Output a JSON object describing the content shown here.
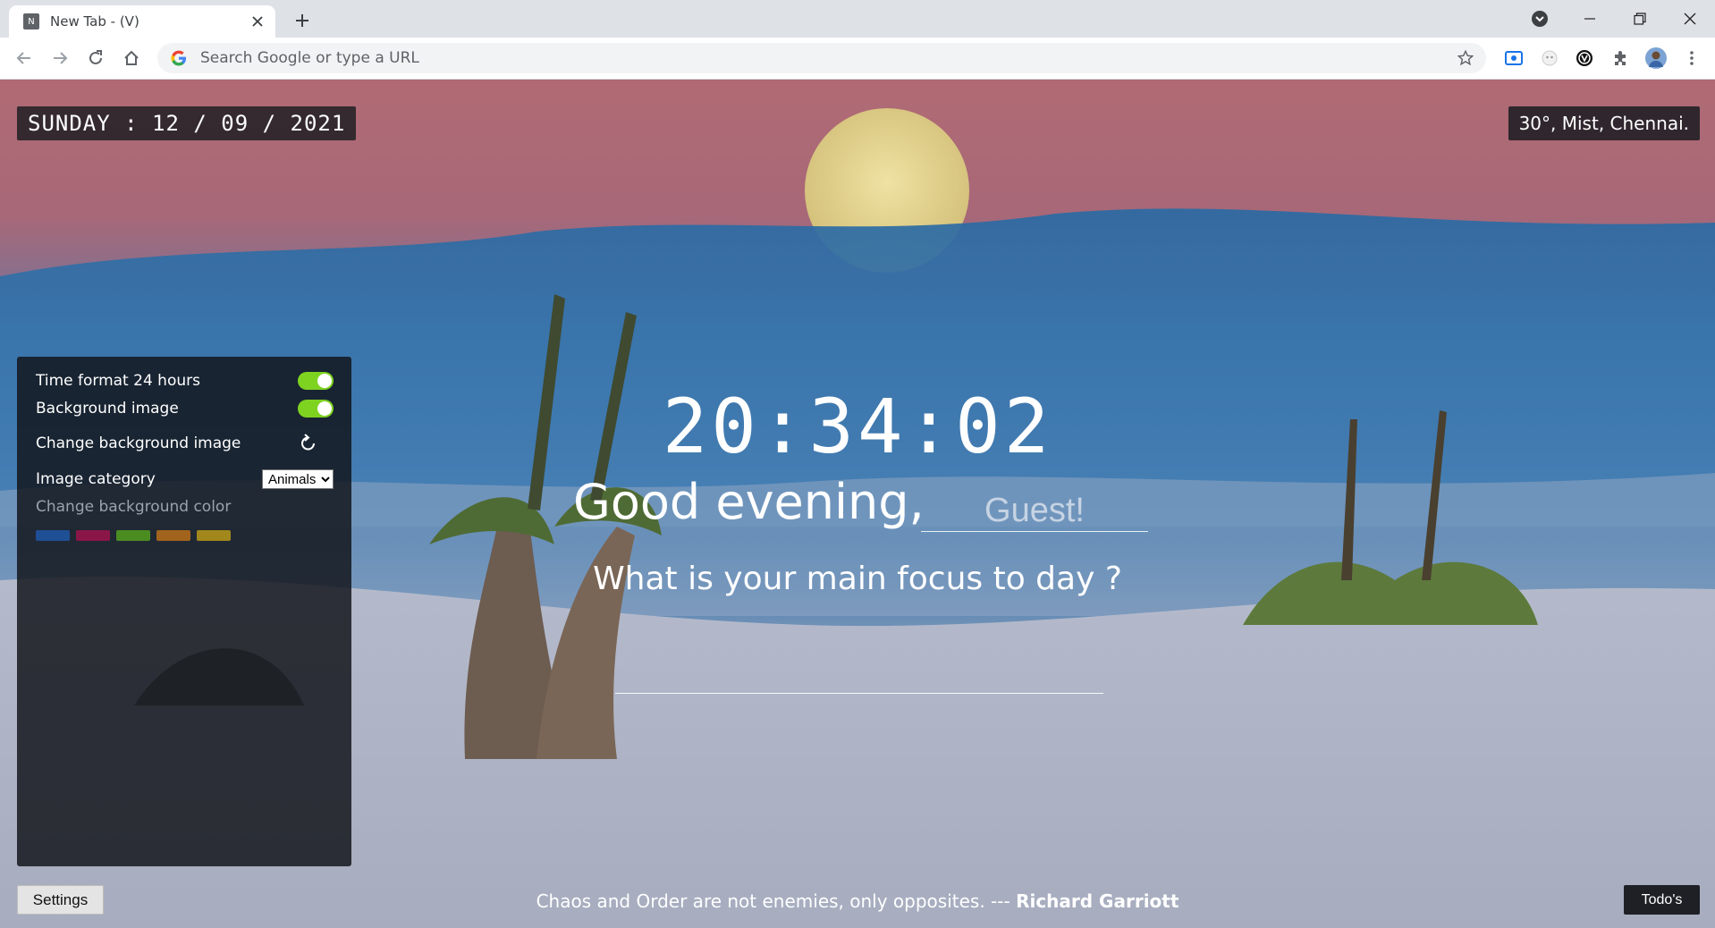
{
  "browser": {
    "tab_title": "New Tab - (V)",
    "tab_favicon_letter": "N",
    "omnibox_placeholder": "Search Google or type a URL"
  },
  "page": {
    "date_text": "SUNDAY : 12 / 09 / 2021",
    "weather_text": "30°, Mist, Chennai.",
    "clock_text": "20:34:02",
    "greeting_text": "Good evening,",
    "name_placeholder": "Guest!",
    "focus_question": "What is your main focus to day ?",
    "quote_text": "Chaos and Order are not enemies, only opposites. --- ",
    "quote_author": "Richard Garriott",
    "settings_button": "Settings",
    "todo_button": "Todo's"
  },
  "settings_panel": {
    "time_format_label": "Time format 24 hours",
    "time_format_on": true,
    "background_image_label": "Background image",
    "background_image_on": true,
    "change_bg_image_label": "Change background image",
    "image_category_label": "Image category",
    "image_category_value": "Animals",
    "change_bg_color_label": "Change background color",
    "color_swatches": [
      "#1f4f95",
      "#8a1647",
      "#4b8c21",
      "#a2641c",
      "#a2871c"
    ]
  }
}
